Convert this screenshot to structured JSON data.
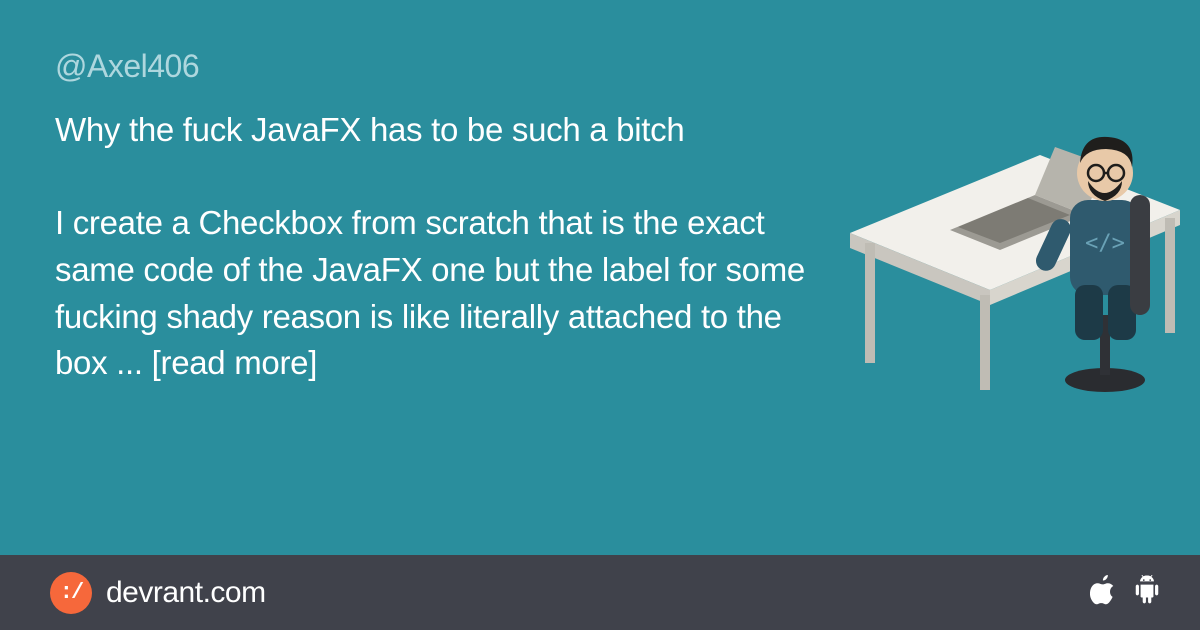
{
  "username_handle": "@Axel406",
  "post": {
    "p1": "Why the fuck JavaFX has to be such a bitch",
    "p2": "I create a Checkbox from scratch that is the exact same code of the JavaFX one but the label for some fucking shady reason is like literally attached to the box ... [read more]"
  },
  "footer": {
    "logo_glyph": ":/",
    "site": "devrant.com"
  },
  "icons": {
    "apple": "apple-icon",
    "android": "android-icon"
  },
  "colors": {
    "background": "#2a8e9d",
    "footer_bg": "#40424b",
    "accent": "#f6683b",
    "text": "#ffffff",
    "muted": "#aed7de"
  }
}
